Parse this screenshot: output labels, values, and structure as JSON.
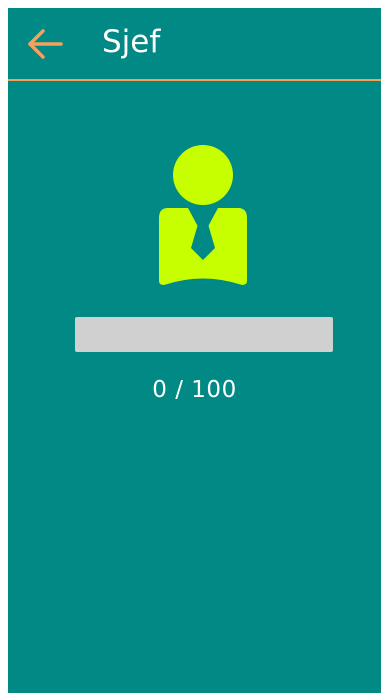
{
  "header": {
    "title": "Sjef",
    "back_icon": "arrow-left-icon"
  },
  "avatar": {
    "icon": "boss-person-icon"
  },
  "progress": {
    "current": "0",
    "separator": " / ",
    "max": "100",
    "fraction": 0
  },
  "colors": {
    "background": "#008985",
    "accent": "#f6a15a",
    "icon": "#c8ff00",
    "track": "#d0d0d0",
    "text": "#ffffff"
  }
}
